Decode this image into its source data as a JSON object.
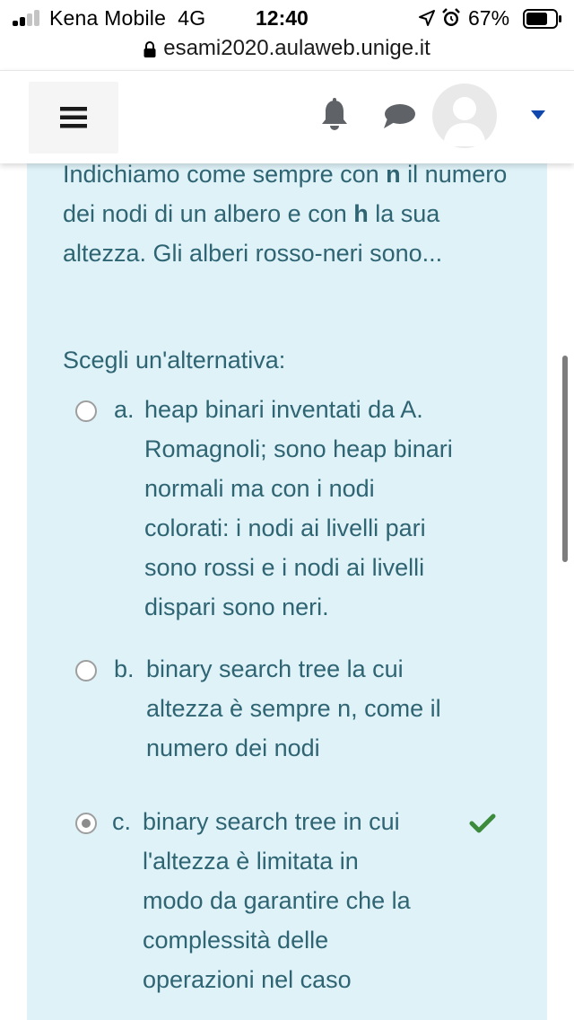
{
  "status_bar": {
    "carrier": "Kena Mobile",
    "network": "4G",
    "time": "12:40",
    "battery": "67%"
  },
  "browser": {
    "url": "esami2020.aulaweb.unige.it"
  },
  "navbar": {
    "menu_icon": "hamburger-icon",
    "notifications_icon": "bell-icon",
    "messages_icon": "chat-icon",
    "user_menu_icon": "caret-down-icon"
  },
  "question": {
    "text_part1": "Indichiamo come sempre con ",
    "bold_n": "n",
    "text_part2": " il numero dei nodi di un albero e con ",
    "bold_h": "h",
    "text_part3": " la sua altezza. Gli alberi rosso-neri sono...",
    "prompt": "Scegli un'alternativa:",
    "answers": [
      {
        "letter": "a.",
        "lines": [
          "heap binari inventati da A.",
          "Romagnoli; sono heap binari",
          "normali ma con i nodi",
          "colorati: i nodi ai livelli pari",
          "sono rossi e i nodi ai livelli",
          "dispari sono neri."
        ],
        "selected": false
      },
      {
        "letter": "b.",
        "lines": [
          "binary search tree la cui",
          "altezza è sempre n, come il",
          "numero dei nodi"
        ],
        "selected": false
      },
      {
        "letter": "c.",
        "lines": [
          "binary search tree in cui",
          "l'altezza è limitata in",
          "modo da garantire che la",
          "complessità delle",
          "operazioni nel caso"
        ],
        "selected": true,
        "correct": true
      }
    ]
  },
  "colors": {
    "question_bg": "#def2f8",
    "question_text": "#2f6473",
    "correct_check": "#3c8a3c",
    "caret": "#0f47ad"
  }
}
